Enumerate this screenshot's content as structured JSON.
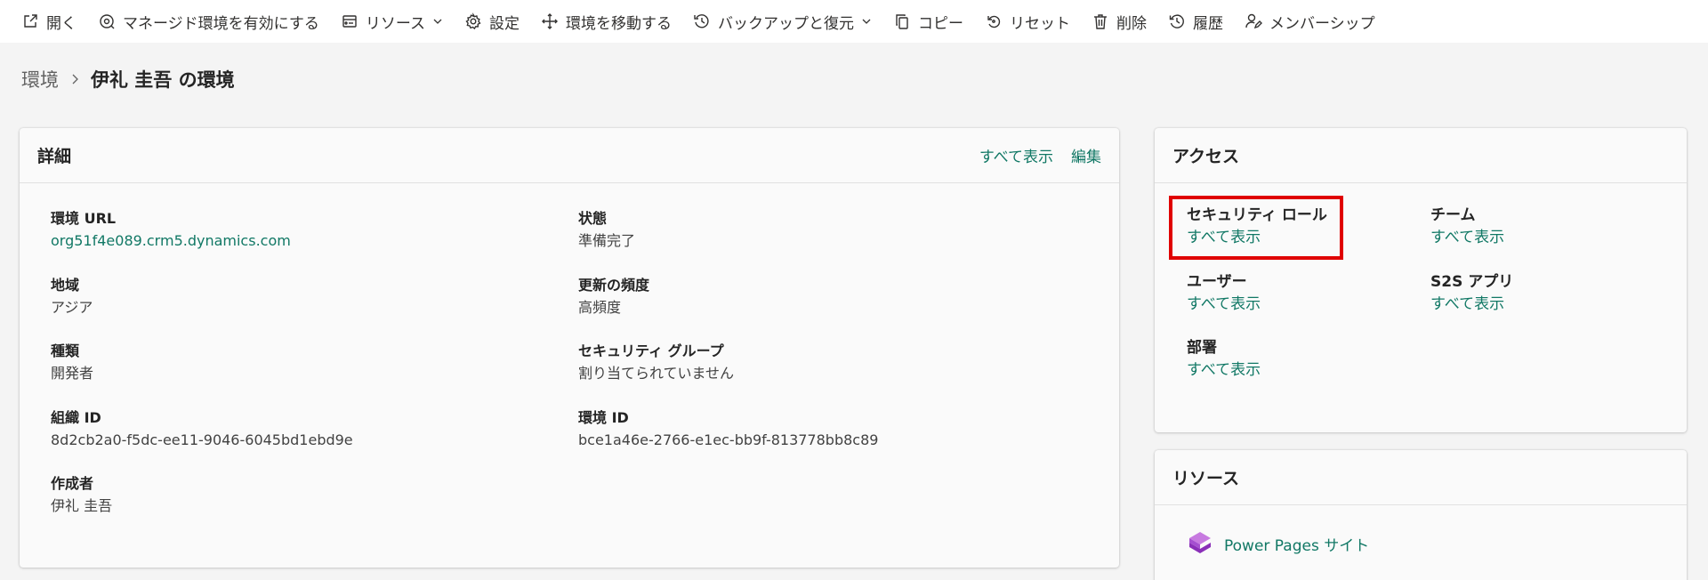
{
  "toolbar": {
    "open": "開く",
    "managed_env": "マネージド環境を有効にする",
    "resources": "リソース",
    "settings": "設定",
    "move_env": "環境を移動する",
    "backup_restore": "バックアップと復元",
    "copy": "コピー",
    "reset": "リセット",
    "delete": "削除",
    "history": "履歴",
    "membership": "メンバーシップ"
  },
  "breadcrumb": {
    "root": "環境",
    "current": "伊礼 圭吾 の環境"
  },
  "details": {
    "title": "詳細",
    "see_all": "すべて表示",
    "edit": "編集",
    "env_url_label": "環境 URL",
    "env_url_value": "org51f4e089.crm5.dynamics.com",
    "state_label": "状態",
    "state_value": "準備完了",
    "region_label": "地域",
    "region_value": "アジア",
    "update_cadence_label": "更新の頻度",
    "update_cadence_value": "高頻度",
    "type_label": "種類",
    "type_value": "開発者",
    "security_group_label": "セキュリティ グループ",
    "security_group_value": "割り当てられていません",
    "org_id_label": "組織 ID",
    "org_id_value": "8d2cb2a0-f5dc-ee11-9046-6045bd1ebd9e",
    "env_id_label": "環境 ID",
    "env_id_value": "bce1a46e-2766-e1ec-bb9f-813778bb8c89",
    "owner_label": "作成者",
    "owner_value": "伊礼 圭吾"
  },
  "access": {
    "title": "アクセス",
    "security_roles_label": "セキュリティ ロール",
    "security_roles_link": "すべて表示",
    "teams_label": "チーム",
    "teams_link": "すべて表示",
    "users_label": "ユーザー",
    "users_link": "すべて表示",
    "s2s_apps_label": "S2S アプリ",
    "s2s_apps_link": "すべて表示",
    "business_units_label": "部署",
    "business_units_link": "すべて表示"
  },
  "resources": {
    "title": "リソース",
    "power_pages": "Power Pages サイト"
  },
  "colors": {
    "accent_link": "#117865",
    "highlight": "#e00000"
  }
}
